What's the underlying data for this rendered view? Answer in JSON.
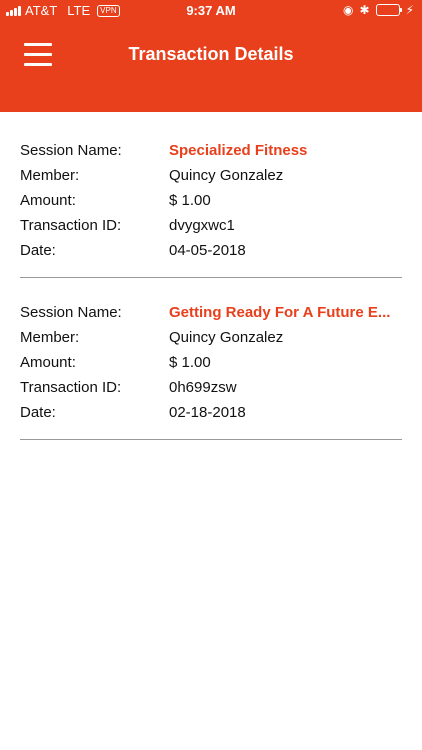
{
  "status": {
    "carrier": "AT&T",
    "network": "LTE",
    "vpn": "VPN",
    "time": "9:37 AM"
  },
  "header": {
    "title": "Transaction Details"
  },
  "labels": {
    "session_name": "Session Name:",
    "member": "Member:",
    "amount": "Amount:",
    "transaction_id": "Transaction ID:",
    "date": "Date:"
  },
  "transactions": [
    {
      "session_name": "Specialized Fitness",
      "member": "Quincy Gonzalez",
      "amount": "$ 1.00",
      "transaction_id": "dvygxwc1",
      "date": "04-05-2018"
    },
    {
      "session_name": "Getting Ready For A Future E...",
      "member": "Quincy Gonzalez",
      "amount": "$ 1.00",
      "transaction_id": "0h699zsw",
      "date": "02-18-2018"
    }
  ],
  "colors": {
    "accent": "#e8401c"
  }
}
